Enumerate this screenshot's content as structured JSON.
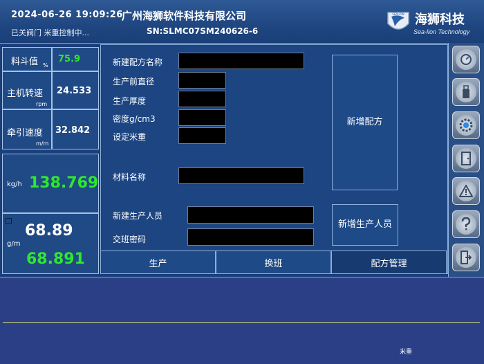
{
  "header": {
    "datetime": "2024-06-26  19:09:26",
    "company": "广州海狮软件科技有限公司",
    "status": "已关阀门 米重控制中...",
    "serial": "SN:SLMC07SM240626-6",
    "logo_text": "海狮科技",
    "logo_sub": "Sea-lion Technology",
    "logo_mark_text": "SEALION"
  },
  "left_panel": {
    "hopper": {
      "label": "料斗值",
      "unit": "%",
      "value": "75.9",
      "value_color": "#2ee82e"
    },
    "main_speed": {
      "label": "主机转速",
      "unit": "rpm",
      "value": "24.533"
    },
    "traction_speed": {
      "label": "牵引速度",
      "unit": "m/m",
      "value": "32.842"
    },
    "output": {
      "unit": "kg/h",
      "value": "138.769",
      "value_color": "#2ee82e"
    },
    "meter_weight": {
      "unit": "g/m",
      "setpoint": "68.89",
      "actual": "68.891",
      "actual_color": "#2ee82e"
    }
  },
  "form": {
    "recipe_name_label": "新建配方名称",
    "pre_diameter_label": "生产前直径",
    "thickness_label": "生产厚度",
    "density_label": "密度g/cm3",
    "set_weight_label": "设定米重",
    "material_label": "材料名称",
    "new_operator_label": "新建生产人员",
    "shift_password_label": "交班密码",
    "add_recipe_button": "新增配方",
    "add_operator_button": "新增生产人员"
  },
  "tabs": [
    "生产",
    "换班",
    "配方管理"
  ],
  "active_tab": "配方管理",
  "sidebar_icons": [
    "dashboard-icon",
    "usb-drive-icon",
    "settings-gear-icon",
    "door-exit-icon",
    "warning-icon",
    "help-icon",
    "exit-icon"
  ],
  "chart": {
    "label": "米重",
    "line_color": "#e4e86a"
  }
}
